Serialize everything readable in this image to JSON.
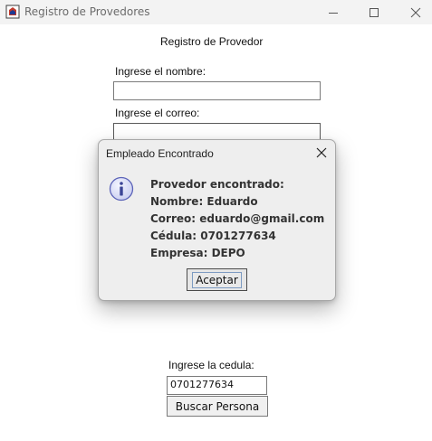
{
  "window": {
    "title": "Registro de Provedores",
    "icon": "java-cup-icon"
  },
  "form": {
    "heading": "Registro de Provedor",
    "name_label": "Ingrese el nombre:",
    "name_value": "",
    "email_label": "Ingrese el correo:",
    "email_value": "",
    "cedula_label": "Ingrese la cedula:",
    "cedula_value": "0701277634",
    "search_button": "Buscar Persona"
  },
  "dialog": {
    "title": "Empleado Encontrado",
    "icon": "info-icon",
    "lines": [
      "Provedor encontrado:",
      "Nombre: Eduardo",
      "Correo: eduardo@gmail.com",
      "Cédula: 0701277634",
      "Empresa: DEPO"
    ],
    "accept_button": "Aceptar"
  },
  "colors": {
    "titlebar_bg": "#f3f3f3",
    "dialog_bg": "#eeeeee",
    "info_icon_fill": "#d9dcf5",
    "info_icon_stroke": "#5b63b8",
    "focus_ring": "#7d9bc2"
  }
}
